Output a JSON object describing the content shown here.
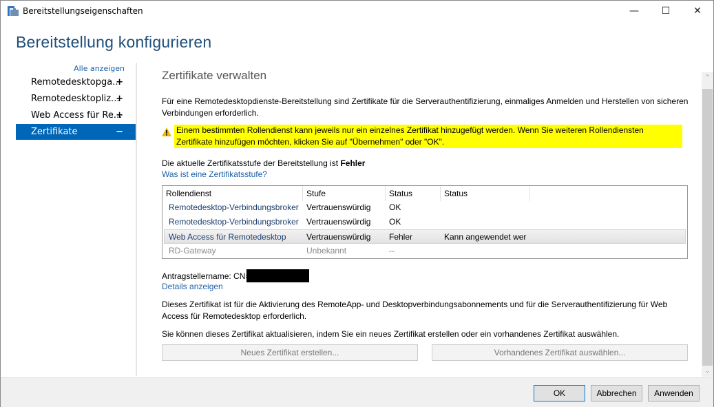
{
  "window": {
    "title": "Bereitstellungseigenschaften"
  },
  "heading": "Bereitstellung konfigurieren",
  "sidebar": {
    "show_all": "Alle anzeigen",
    "items": [
      {
        "label": "Remotedesktopga...",
        "sign": "+"
      },
      {
        "label": "Remotedesktopliz...",
        "sign": "+"
      },
      {
        "label": "Web Access für Re...",
        "sign": "+"
      },
      {
        "label": "Zertifikate",
        "sign": "−",
        "selected": true
      }
    ]
  },
  "main": {
    "section_title": "Zertifikate verwalten",
    "intro": "Für eine Remotedesktopdienste-Bereitstellung sind Zertifikate für die Serverauthentifizierung, einmaliges Anmelden und Herstellen von sicheren Verbindungen erforderlich.",
    "warning": "Einem bestimmten Rollendienst kann jeweils nur ein einzelnes Zertifikat hinzugefügt werden. Wenn Sie weiteren Rollendiensten Zertifikate hinzufügen möchten, klicken Sie auf \"Übernehmen\" oder \"OK\".",
    "level_prefix": "Die aktuelle Zertifikatsstufe der Bereitstellung ist ",
    "level_value": "Fehler",
    "level_link": "Was ist eine Zertifikatsstufe?",
    "table": {
      "columns": [
        "Rollendienst",
        "Stufe",
        "Status",
        "Status"
      ],
      "rows": [
        [
          "Remotedesktop-Verbindungsbroker",
          "Vertrauenswürdig",
          "OK",
          ""
        ],
        [
          "Remotedesktop-Verbindungsbroker",
          "Vertrauenswürdig",
          "OK",
          ""
        ],
        [
          "Web Access für Remotedesktop",
          "Vertrauenswürdig",
          "Fehler",
          "Kann angewendet wer"
        ],
        [
          "RD-Gateway",
          "Unbekannt",
          "--",
          ""
        ]
      ]
    },
    "subject_label": "Antragstellername: CN=",
    "details_link": "Details anzeigen",
    "desc1": "Dieses Zertifikat ist für die Aktivierung des RemoteApp- und Desktopverbindungsabonnements und für die Serverauthentifizierung für Web Access für Remotedesktop erforderlich.",
    "desc2": "Sie können dieses Zertifikat aktualisieren, indem Sie ein neues Zertifikat erstellen oder ein vorhandenes Zertifikat auswählen.",
    "new_cert": "Neues Zertifikat erstellen...",
    "existing_cert": "Vorhandenes Zertifikat auswählen..."
  },
  "footer": {
    "ok": "OK",
    "cancel": "Abbrechen",
    "apply": "Anwenden"
  },
  "colors": {
    "accent": "#0067b8",
    "highlight": "#ffff00",
    "heading": "#1e4e79"
  }
}
